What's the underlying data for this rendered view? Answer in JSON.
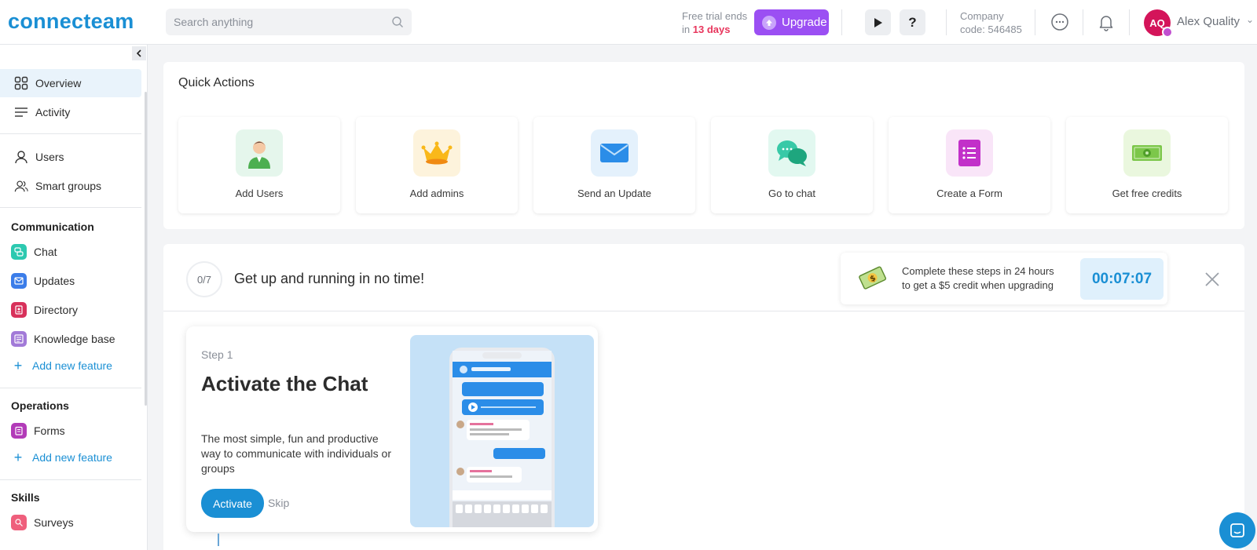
{
  "header": {
    "logo": "connecteam",
    "search_placeholder": "Search anything",
    "trial_line1": "Free trial ends",
    "trial_prefix": "in",
    "trial_days": "13 days",
    "upgrade_label": "Upgrade",
    "help_label": "?",
    "company_label": "Company",
    "company_code": "code: 546485",
    "avatar_initials": "AQ",
    "username": "Alex Quality"
  },
  "sidebar": {
    "top_items": [
      {
        "label": "Overview",
        "icon": "grid-icon"
      },
      {
        "label": "Activity",
        "icon": "lines-icon"
      }
    ],
    "people_items": [
      {
        "label": "Users",
        "icon": "user-icon"
      },
      {
        "label": "Smart groups",
        "icon": "users-icon"
      }
    ],
    "communication": {
      "title": "Communication",
      "items": [
        {
          "label": "Chat",
          "color": "#2cc9b0"
        },
        {
          "label": "Updates",
          "color": "#3b7de9"
        },
        {
          "label": "Directory",
          "color": "#d8315b"
        },
        {
          "label": "Knowledge base",
          "color": "#a27ad8"
        }
      ],
      "add_label": "Add new feature"
    },
    "operations": {
      "title": "Operations",
      "items": [
        {
          "label": "Forms",
          "color": "#b23bb8"
        }
      ],
      "add_label": "Add new feature"
    },
    "skills": {
      "title": "Skills",
      "items": [
        {
          "label": "Surveys",
          "color": "#ef5f7c"
        }
      ]
    }
  },
  "quick_actions": {
    "title": "Quick Actions",
    "cards": [
      {
        "label": "Add Users",
        "icon": "user-avatar-icon",
        "bg": "#e5f6ec"
      },
      {
        "label": "Add admins",
        "icon": "crown-icon",
        "bg": "#fdf3dc"
      },
      {
        "label": "Send an Update",
        "icon": "envelope-icon",
        "bg": "#e4f1fc"
      },
      {
        "label": "Go to chat",
        "icon": "chat-bubbles-icon",
        "bg": "#e2f8f0"
      },
      {
        "label": "Create a Form",
        "icon": "form-icon",
        "bg": "#f9e5f8"
      },
      {
        "label": "Get free credits",
        "icon": "cash-icon",
        "bg": "#eaf7de"
      }
    ]
  },
  "getting_started": {
    "progress": "0/7",
    "title": "Get up and running in no time!",
    "credit_line1": "Complete these steps in 24 hours",
    "credit_line2": "to get a $5 credit when upgrading",
    "timer": "00:07:07",
    "step": {
      "number": "Step 1",
      "title": "Activate the Chat",
      "description": "The most simple, fun and productive way to communicate with individuals or groups",
      "activate_label": "Activate",
      "skip_label": "Skip"
    }
  }
}
